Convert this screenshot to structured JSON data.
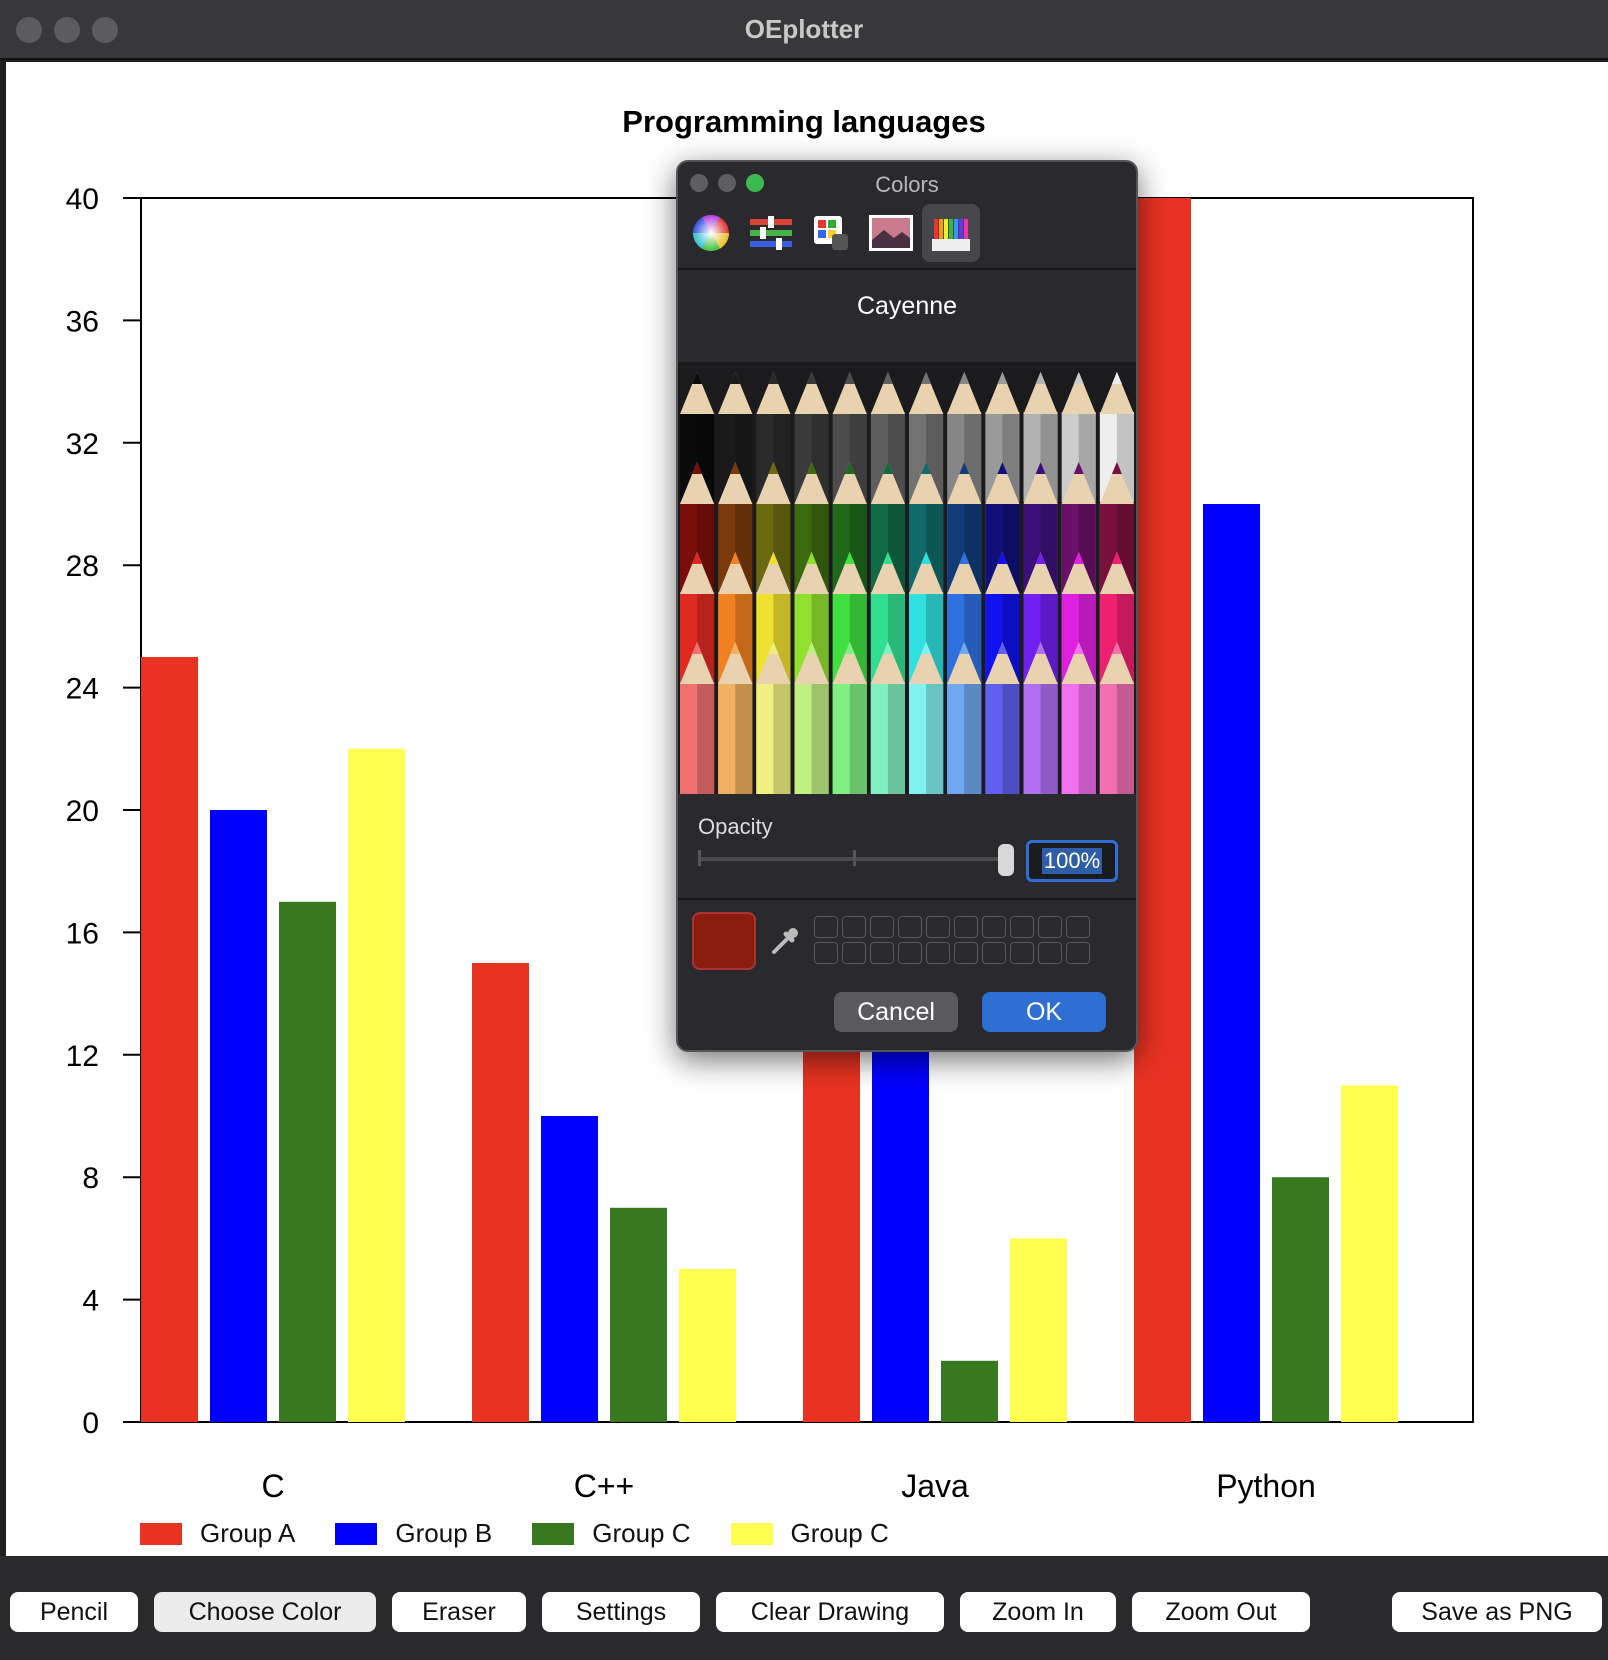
{
  "window": {
    "title": "OEplotter"
  },
  "chart_data": {
    "type": "bar",
    "title": "Programming languages",
    "categories": [
      "C",
      "C++",
      "Java",
      "Python"
    ],
    "series": [
      {
        "name": "Group A",
        "color": "#e83323",
        "values": [
          25,
          15,
          13,
          40
        ]
      },
      {
        "name": "Group B",
        "color": "#0000ff",
        "values": [
          20,
          10,
          13,
          30
        ]
      },
      {
        "name": "Group C",
        "color": "#38791f",
        "values": [
          17,
          7,
          2,
          8
        ]
      },
      {
        "name": "Group C",
        "color": "#fffe50",
        "values": [
          22,
          5,
          6,
          11
        ]
      }
    ],
    "yticks": [
      0,
      4,
      8,
      12,
      16,
      20,
      24,
      28,
      32,
      36,
      40
    ],
    "ylim": [
      0,
      40
    ],
    "legend": "bottom-left"
  },
  "toolbar": {
    "pencil": "Pencil",
    "choose_color": "Choose Color",
    "eraser": "Eraser",
    "settings": "Settings",
    "clear_drawing": "Clear Drawing",
    "zoom_in": "Zoom In",
    "zoom_out": "Zoom Out",
    "save_png": "Save as PNG"
  },
  "color_picker": {
    "title": "Colors",
    "selected_color_name": "Cayenne",
    "selected_color": "#8b1d0f",
    "opacity_label": "Opacity",
    "opacity_value": "100%",
    "opacity_fraction": 1.0,
    "cancel": "Cancel",
    "ok": "OK",
    "tabs": [
      "color-wheel-icon",
      "sliders-icon",
      "palettes-icon",
      "image-palette-icon",
      "pencils-icon"
    ]
  }
}
